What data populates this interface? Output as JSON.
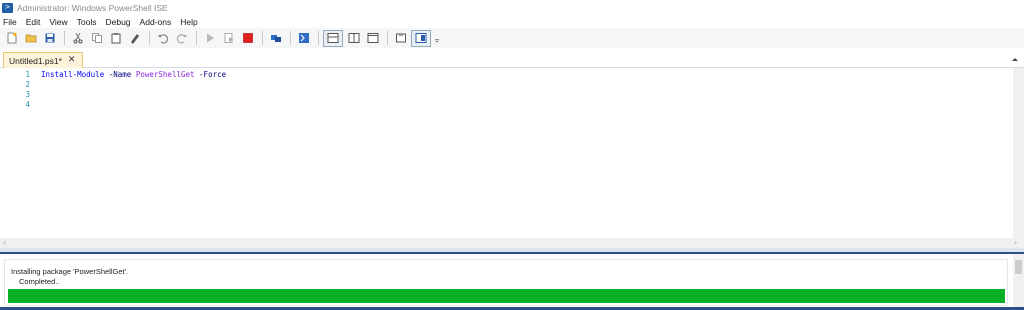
{
  "window": {
    "title": "Administrator: Windows PowerShell ISE"
  },
  "menu": {
    "items": [
      "File",
      "Edit",
      "View",
      "Tools",
      "Debug",
      "Add-ons",
      "Help"
    ]
  },
  "toolbar": {
    "icons": [
      "new-script-icon",
      "open-icon",
      "save-icon",
      "cut-icon",
      "copy-icon",
      "paste-icon",
      "clear-console-icon",
      "undo-icon",
      "redo-icon",
      "run-script-icon",
      "run-selection-icon",
      "stop-icon",
      "remote-powershell-icon",
      "powershell-console-icon",
      "show-script-top-icon",
      "show-script-right-icon",
      "show-script-maximized-icon",
      "show-command-addon-icon",
      "show-command-window-icon",
      "overflow-icon"
    ]
  },
  "tabs": [
    {
      "label": "Untitled1.ps1*",
      "active": true
    }
  ],
  "editor": {
    "line_numbers": [
      "1",
      "2",
      "3",
      "4"
    ],
    "line1": {
      "cmdlet": "Install-Module",
      "param1": "-Name",
      "value1": "PowerShellGet",
      "param2": "-Force"
    }
  },
  "progress": {
    "activity": "Installing package 'PowerShellGet'.",
    "status": "Completed..",
    "percent": 100,
    "bar_color": "#06b025"
  },
  "colors": {
    "cmdlet": "#0000ff",
    "parameter": "#000080",
    "argument": "#8a2be2",
    "line_number": "#2b91af",
    "active_tab": "#fdf3da"
  }
}
